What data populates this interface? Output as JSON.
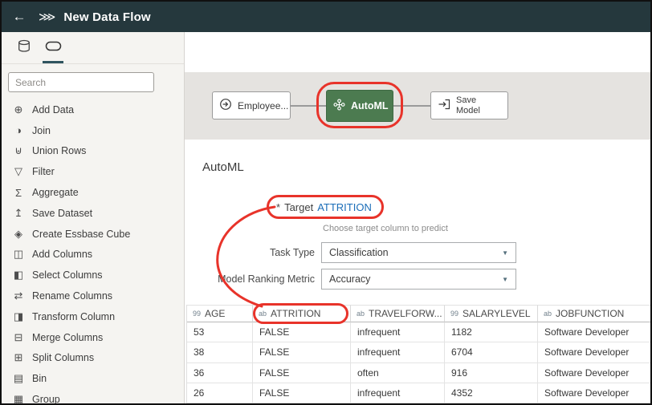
{
  "header": {
    "title": "New Data Flow"
  },
  "icons": {
    "back": "←",
    "breadcrumb": "⋙",
    "caret": "▼"
  },
  "sidebar": {
    "search_placeholder": "Search",
    "items": [
      {
        "icon": "⊕",
        "label": "Add Data"
      },
      {
        "icon": "◑",
        "label": "Join"
      },
      {
        "icon": "⊎",
        "label": "Union Rows"
      },
      {
        "icon": "▽",
        "label": "Filter"
      },
      {
        "icon": "Σ",
        "label": "Aggregate"
      },
      {
        "icon": "↥",
        "label": "Save Dataset"
      },
      {
        "icon": "◈",
        "label": "Create Essbase Cube"
      },
      {
        "icon": "◫",
        "label": "Add Columns"
      },
      {
        "icon": "◧",
        "label": "Select Columns"
      },
      {
        "icon": "⇄",
        "label": "Rename Columns"
      },
      {
        "icon": "◨",
        "label": "Transform Column"
      },
      {
        "icon": "⊟",
        "label": "Merge Columns"
      },
      {
        "icon": "⊞",
        "label": "Split Columns"
      },
      {
        "icon": "▤",
        "label": "Bin"
      },
      {
        "icon": "▦",
        "label": "Group"
      }
    ]
  },
  "flow": {
    "nodes": [
      {
        "label": "Employee..."
      },
      {
        "label": "AutoML"
      },
      {
        "label": "Save Model"
      }
    ]
  },
  "panel": {
    "title": "AutoML",
    "target_required": "*",
    "target_label": "Target",
    "target_value": "ATTRITION",
    "target_help": "Choose target column to predict",
    "fields": [
      {
        "label": "Task Type",
        "value": "Classification"
      },
      {
        "label": "Model Ranking Metric",
        "value": "Accuracy"
      }
    ]
  },
  "table": {
    "columns": [
      {
        "type": "99",
        "name": "AGE"
      },
      {
        "type": "ab",
        "name": "ATTRITION"
      },
      {
        "type": "ab",
        "name": "TRAVELFORW..."
      },
      {
        "type": "99",
        "name": "SALARYLEVEL"
      },
      {
        "type": "ab",
        "name": "JOBFUNCTION"
      }
    ],
    "rows": [
      [
        "53",
        "FALSE",
        "infrequent",
        "1182",
        "Software Developer"
      ],
      [
        "38",
        "FALSE",
        "infrequent",
        "6704",
        "Software Developer"
      ],
      [
        "36",
        "FALSE",
        "often",
        "916",
        "Software Developer"
      ],
      [
        "26",
        "FALSE",
        "infrequent",
        "4352",
        "Software Developer"
      ]
    ]
  },
  "colors": {
    "header_bg": "#25383d",
    "node_green": "#4c7b50",
    "annotation_red": "#e8332a",
    "link_blue": "#1a6db8"
  }
}
